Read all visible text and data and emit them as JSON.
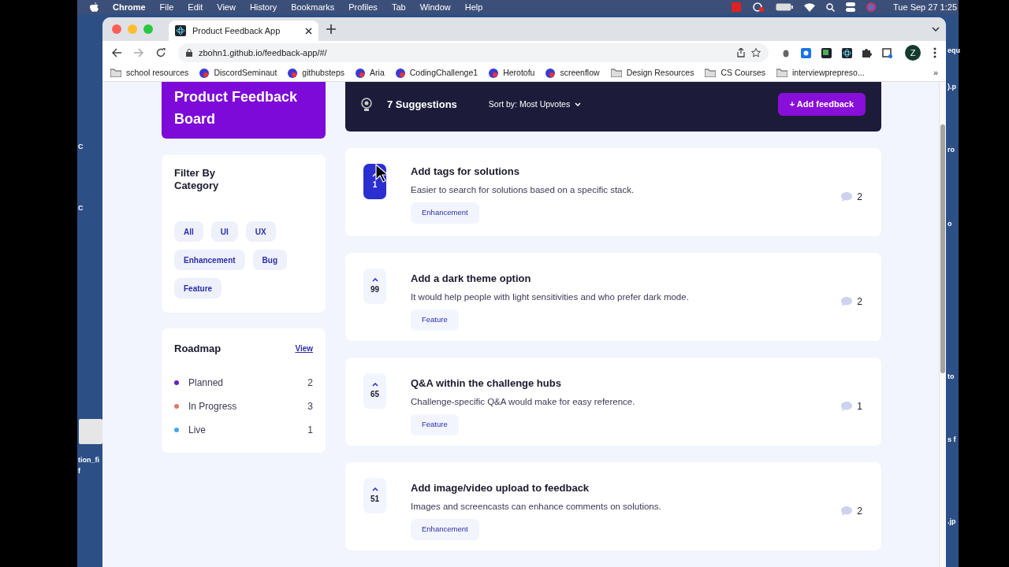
{
  "menubar": {
    "app": "Chrome",
    "items": [
      "File",
      "Edit",
      "View",
      "History",
      "Bookmarks",
      "Profiles",
      "Tab",
      "Window",
      "Help"
    ],
    "clock": "Tue Sep 27  1:25"
  },
  "desktop_left": [
    "C",
    "C",
    "tion_fi",
    "f"
  ],
  "desktop_right": [
    "equ",
    ").p",
    "ro",
    "o",
    "to",
    "s f",
    ".jp"
  ],
  "browser": {
    "tab": {
      "title": "Product Feedback App"
    },
    "url": "zbohn1.github.io/feedback-app/#/",
    "profile": "Z",
    "bookmarks": [
      {
        "label": "school resources",
        "kind": "folder"
      },
      {
        "label": "DiscordSeminaut",
        "kind": "site"
      },
      {
        "label": "githubsteps",
        "kind": "site"
      },
      {
        "label": "Aria",
        "kind": "site"
      },
      {
        "label": "CodingChallenge1",
        "kind": "site"
      },
      {
        "label": "Herotofu",
        "kind": "site"
      },
      {
        "label": "screenflow",
        "kind": "site"
      },
      {
        "label": "Design Resources",
        "kind": "folder"
      },
      {
        "label": "CS Courses",
        "kind": "folder"
      },
      {
        "label": "interviewprepreso...",
        "kind": "folder"
      }
    ],
    "more": "»"
  },
  "board": {
    "title": "Product Feedback Board"
  },
  "filter": {
    "title": "Filter By Category",
    "tags": [
      {
        "label": "All",
        "selected": false
      },
      {
        "label": "UI",
        "selected": false
      },
      {
        "label": "UX",
        "selected": false
      },
      {
        "label": "Enhancement",
        "selected": false
      },
      {
        "label": "Bug",
        "selected": false
      },
      {
        "label": "Feature",
        "selected": false
      }
    ]
  },
  "roadmap": {
    "title": "Roadmap",
    "link": "View",
    "items": [
      {
        "label": "Planned",
        "count": "2",
        "color": "#6a1fc2"
      },
      {
        "label": "In Progress",
        "count": "3",
        "color": "#e07a67"
      },
      {
        "label": "Live",
        "count": "1",
        "color": "#49a6e8"
      }
    ]
  },
  "toolbar": {
    "count": "7 Suggestions",
    "sort": "Sort by: Most Upvotes",
    "button": "+ Add feedback"
  },
  "suggestions": [
    {
      "title": "Add tags for solutions",
      "description": "Easier to search for solutions based on a specific stack.",
      "tag": "Enhancement",
      "upvotes": "1",
      "upvoted": true,
      "comments": "2"
    },
    {
      "title": "Add a dark theme option",
      "description": "It would help people with light sensitivities and who prefer dark mode.",
      "tag": "Feature",
      "upvotes": "99",
      "upvoted": false,
      "comments": "2"
    },
    {
      "title": "Q&A within the challenge hubs",
      "description": "Challenge-specific Q&A would make for easy reference.",
      "tag": "Feature",
      "upvotes": "65",
      "upvoted": false,
      "comments": "1"
    },
    {
      "title": "Add image/video upload to feedback",
      "description": "Images and screencasts can enhance comments on solutions.",
      "tag": "Enhancement",
      "upvotes": "51",
      "upvoted": false,
      "comments": "2"
    }
  ]
}
